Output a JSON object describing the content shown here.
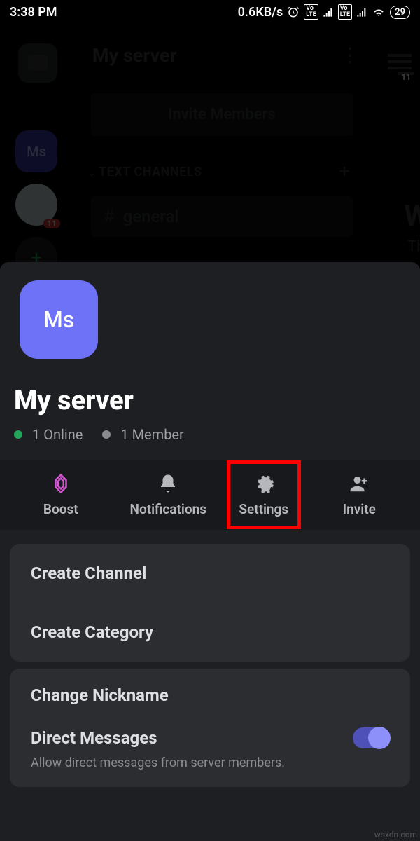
{
  "status": {
    "time": "3:38 PM",
    "speed": "0.6KB/s",
    "battery": "29",
    "lte": "Vo LTE"
  },
  "background": {
    "server_title": "My server",
    "invite_label": "Invite Members",
    "tc_header": "TEXT CHANNELS",
    "channel_general": "general",
    "ms_initials": "Ms",
    "badge_count": "11",
    "menu_badge": "11",
    "welcome_fragment": "We",
    "this_fragment": "This"
  },
  "sheet": {
    "icon_initials": "Ms",
    "title": "My server",
    "online_count": "1 Online",
    "member_count": "1 Member",
    "actions": {
      "boost": "Boost",
      "notifications": "Notifications",
      "settings": "Settings",
      "invite": "Invite"
    },
    "options": {
      "create_channel": "Create Channel",
      "create_category": "Create Category",
      "change_nickname": "Change Nickname",
      "dm_title": "Direct Messages",
      "dm_sub": "Allow direct messages from server members."
    }
  },
  "watermark": "wsxdn.com"
}
